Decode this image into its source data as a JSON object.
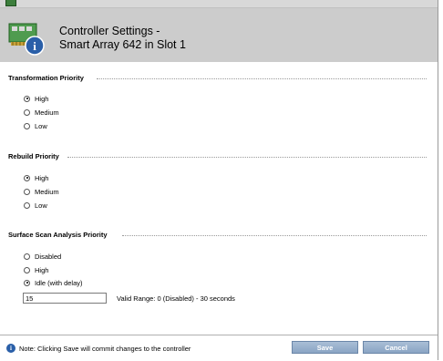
{
  "header": {
    "title_line1": "Controller Settings -",
    "title_line2": "Smart Array 642 in Slot 1",
    "icon": "controller-card-info-icon"
  },
  "sections": {
    "transformation": {
      "title": "Transformation Priority",
      "options": [
        "High",
        "Medium",
        "Low"
      ],
      "selected": "High"
    },
    "rebuild": {
      "title": "Rebuild Priority",
      "options": [
        "High",
        "Medium",
        "Low"
      ],
      "selected": "High"
    },
    "surface_scan": {
      "title": "Surface Scan Analysis Priority",
      "options": [
        "Disabled",
        "High",
        "Idle (with delay)"
      ],
      "selected": "Idle (with delay)",
      "delay_value": "15",
      "valid_range": "Valid Range: 0 (Disabled) - 30 seconds"
    }
  },
  "footer": {
    "note": "Note: Clicking Save will commit changes to the controller",
    "save_label": "Save",
    "cancel_label": "Cancel"
  },
  "colors": {
    "header_bg": "#cccccc",
    "button_bg": "#8aa5c4",
    "info_icon": "#2a5fa8"
  }
}
